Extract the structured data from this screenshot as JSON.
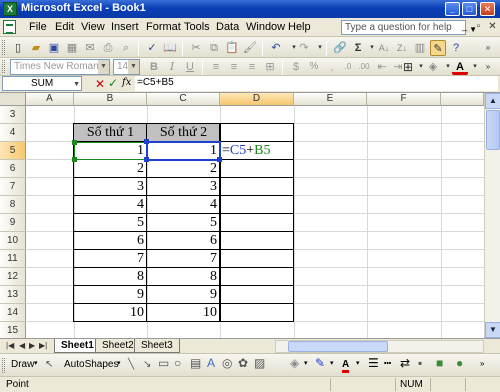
{
  "window": {
    "title": "Microsoft Excel - Book1"
  },
  "menu": {
    "items": [
      "File",
      "Edit",
      "View",
      "Insert",
      "Format",
      "Tools",
      "Data",
      "Window",
      "Help"
    ],
    "help_placeholder": "Type a question for help"
  },
  "formatting": {
    "font": "Times New Roman",
    "size": "14"
  },
  "formula_bar": {
    "name_box": "SUM",
    "fx": "fx",
    "formula": "=C5+B5"
  },
  "columns": [
    "A",
    "B",
    "C",
    "D",
    "E",
    "F"
  ],
  "selected_column": "D",
  "rows": [
    "3",
    "4",
    "5",
    "6",
    "7",
    "8",
    "9",
    "10",
    "11",
    "12",
    "13",
    "14",
    "15"
  ],
  "selected_row": "5",
  "table": {
    "headers": [
      "Số thứ 1",
      "Số thứ 2"
    ],
    "col_b": [
      "1",
      "2",
      "3",
      "4",
      "5",
      "6",
      "7",
      "8",
      "9",
      "10"
    ],
    "col_c": [
      "1",
      "2",
      "3",
      "4",
      "5",
      "6",
      "7",
      "8",
      "9",
      "10"
    ]
  },
  "editing_cell": {
    "eq": "=",
    "ref1": "C5",
    "plus": "+",
    "ref2": "B5"
  },
  "ref_colors": {
    "c5": "#2040d0",
    "b5": "#1a8a1a"
  },
  "sheets": [
    "Sheet1",
    "Sheet2",
    "Sheet3"
  ],
  "active_sheet": "Sheet1",
  "drawing": {
    "draw": "Draw",
    "autoshapes": "AutoShapes"
  },
  "status": {
    "mode": "Point",
    "num": "NUM"
  }
}
